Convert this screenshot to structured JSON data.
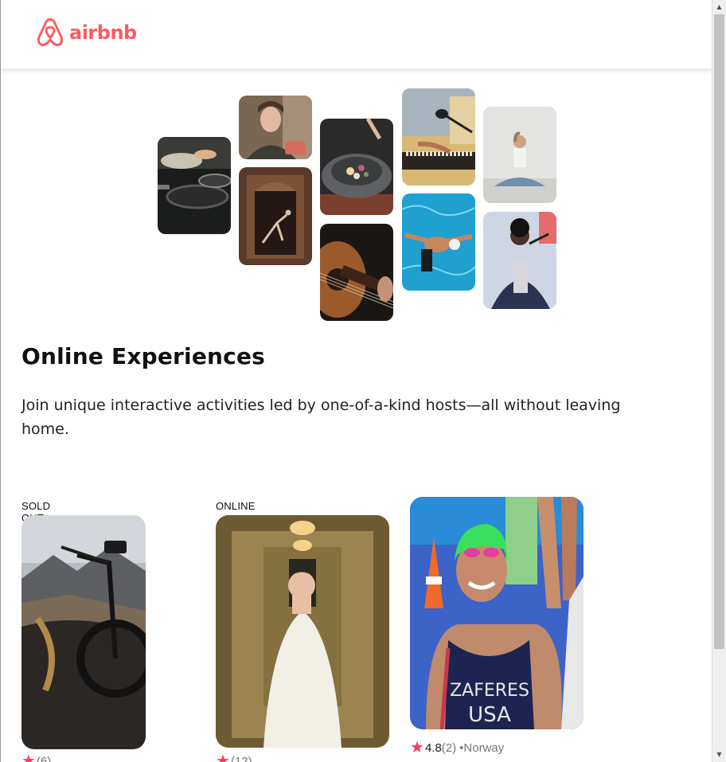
{
  "brand": {
    "name": "airbnb",
    "color": "#ff5a5f",
    "logo_icon": "airbnb-belo-icon"
  },
  "hero": {
    "tiles": [
      {
        "name": "cooking-pans",
        "alt": "cooking"
      },
      {
        "name": "woman-portrait",
        "alt": "woman smiling"
      },
      {
        "name": "dancer-doorway",
        "alt": "dancer"
      },
      {
        "name": "food-bowl",
        "alt": "plated food"
      },
      {
        "name": "guitar",
        "alt": "guitar"
      },
      {
        "name": "microphone-keyboard",
        "alt": "music"
      },
      {
        "name": "swimmer-pool",
        "alt": "swimmer"
      },
      {
        "name": "yoga",
        "alt": "yoga"
      },
      {
        "name": "singer",
        "alt": "singer"
      }
    ]
  },
  "section": {
    "title": "Online Experiences",
    "description": "Join unique interactive activities led by one-of-a-kind hosts—all without leaving home."
  },
  "cards": [
    {
      "badge": "SOLD OUT",
      "image": "mountain-bike",
      "rating": "",
      "count": "(6)",
      "location": ""
    },
    {
      "badge": "ONLINE",
      "image": "bride-hallway",
      "rating": "",
      "count": "(12)",
      "location": ""
    },
    {
      "badge": "",
      "image": "swimmer-athlete",
      "rating": "4.8",
      "count": "(2)",
      "location": "•Norway"
    }
  ],
  "colors": {
    "star": "#fe395c",
    "muted": "#777777"
  }
}
